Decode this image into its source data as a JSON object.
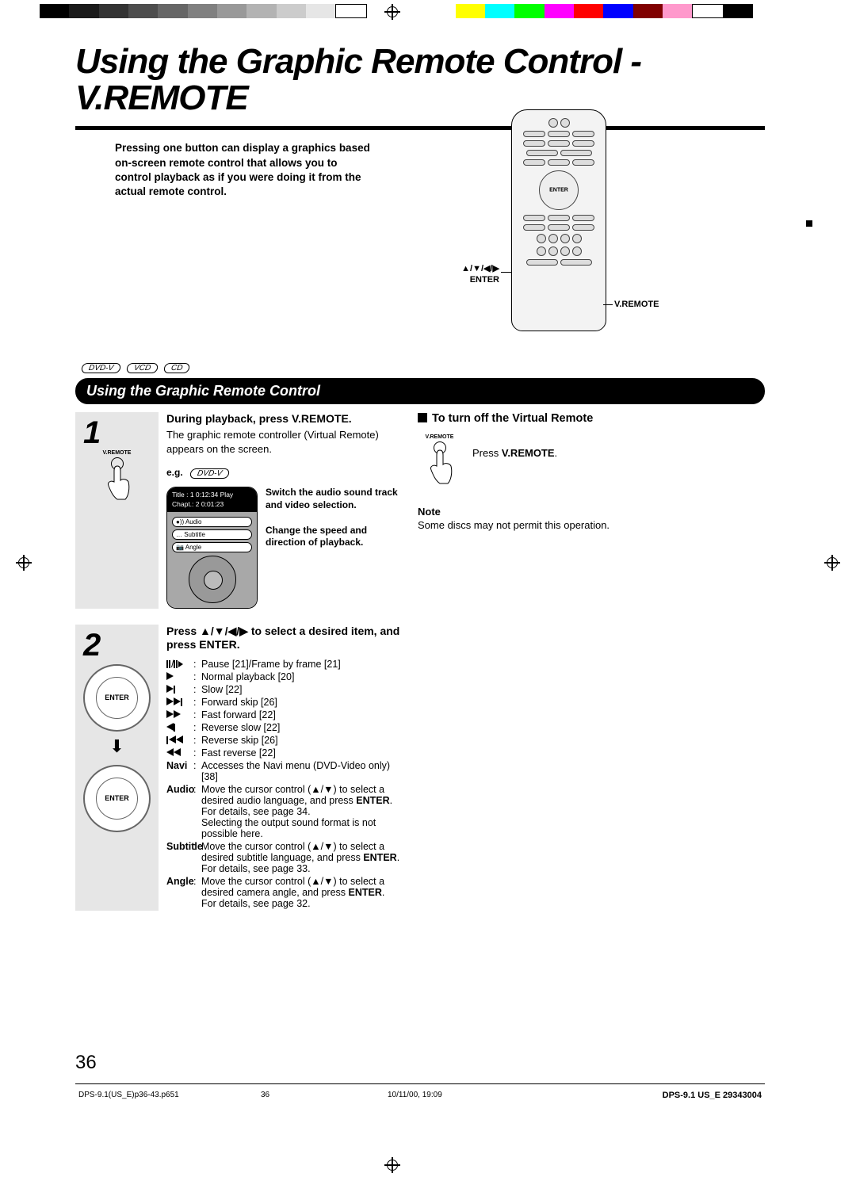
{
  "title": "Using the Graphic Remote Control - V.REMOTE",
  "intro": "Pressing one button can display a graphics based on-screen remote control that allows you to control playback as if you were doing it from the actual remote control.",
  "callouts": {
    "cursor": "▲/▼/◀/▶\nENTER",
    "vremote": "V.REMOTE"
  },
  "disc_badges": [
    "DVD-V",
    "VCD",
    "CD"
  ],
  "section_title": "Using the Graphic Remote Control",
  "step1": {
    "num": "1",
    "icon_tag": "V.REMOTE",
    "head": "During playback, press V.REMOTE.",
    "desc": "The graphic remote controller (Virtual Remote) appears on the screen.",
    "eg_label": "e.g.",
    "eg_badge": "DVD-V",
    "osd": {
      "hdr_l1": "Title : 1     0:12:34     Play",
      "hdr_l2": "Chapt.: 2    0:01:23",
      "opts": [
        "●)) Audio",
        "… Subtitle",
        "📷 Angle"
      ]
    },
    "caption_a": "Switch the audio sound track and video selection.",
    "caption_b": "Change the speed and direction of playback."
  },
  "step2": {
    "num": "2",
    "head": "Press ▲/▼/◀/▶ to select a desired item, and press ENTER.",
    "enter_label": "ENTER",
    "functions": [
      {
        "icon": "pause-step",
        "label": "",
        "text": "Pause [21]/Frame by frame [21]"
      },
      {
        "icon": "play",
        "label": "",
        "text": "Normal playback [20]"
      },
      {
        "icon": "slow-fwd",
        "label": "",
        "text": "Slow [22]"
      },
      {
        "icon": "skip-fwd",
        "label": "",
        "text": "Forward skip [26]"
      },
      {
        "icon": "ffwd",
        "label": "",
        "text": "Fast forward [22]"
      },
      {
        "icon": "slow-rev",
        "label": "",
        "text": "Reverse slow [22]"
      },
      {
        "icon": "skip-rev",
        "label": "",
        "text": "Reverse skip [26]"
      },
      {
        "icon": "frev",
        "label": "",
        "text": "Fast reverse [22]"
      },
      {
        "icon": "",
        "label": "Navi",
        "text": "Accesses the Navi menu (DVD-Video only) [38]"
      },
      {
        "icon": "",
        "label": "Audio",
        "text": "Move the cursor control (▲/▼) to select a desired audio language, and press ENTER.\nFor details, see page 34.\nSelecting the output sound format is not possible here."
      },
      {
        "icon": "",
        "label": "Subtitle",
        "text": "Move the cursor control (▲/▼) to select a desired subtitle language, and press ENTER.\nFor details, see page 33."
      },
      {
        "icon": "",
        "label": "Angle",
        "text": "Move the cursor control (▲/▼) to select a desired camera angle, and press ENTER.\nFor details, see page 32."
      }
    ]
  },
  "right": {
    "head": "To turn off the Virtual Remote",
    "icon_tag": "V.REMOTE",
    "press_prefix": "Press ",
    "press_bold": "V.REMOTE",
    "press_suffix": ".",
    "note_h": "Note",
    "note_t": "Some discs may not permit this operation."
  },
  "page_num": "36",
  "footer": {
    "file": "DPS-9.1(US_E)p36-43.p651",
    "page": "36",
    "date": "10/11/00, 19:09",
    "doc": "DPS-9.1 US_E  29343004"
  }
}
